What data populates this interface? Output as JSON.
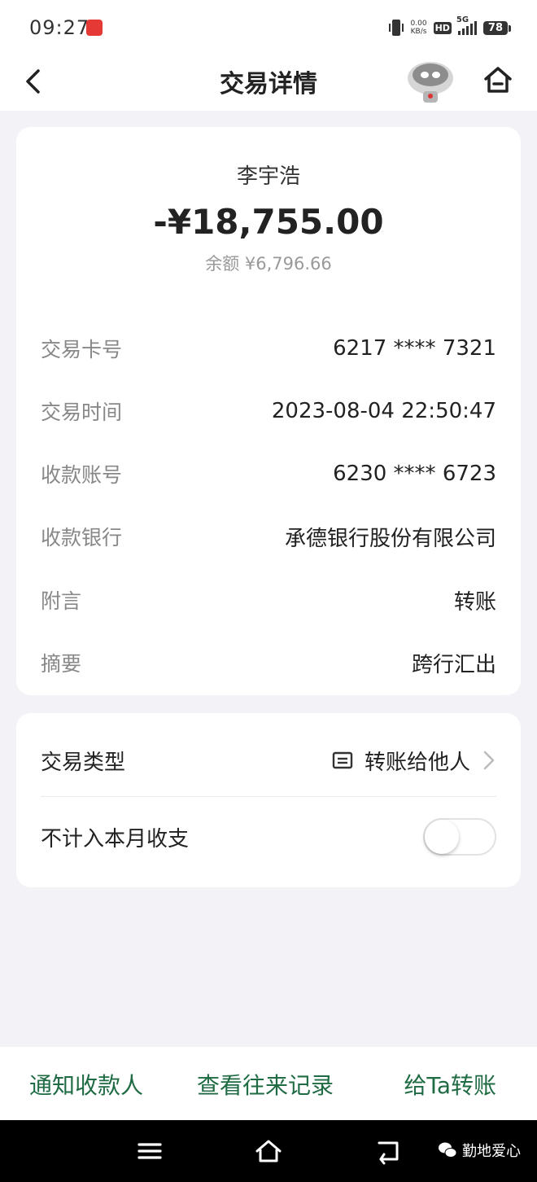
{
  "status_bar": {
    "time": "09:27",
    "net_speed_value": "0.00",
    "net_speed_unit": "KB/s",
    "hd": "HD",
    "network": "5G",
    "battery": "78"
  },
  "header": {
    "title": "交易详情",
    "back_icon": "chevron-left-icon",
    "home_icon": "home-icon"
  },
  "summary": {
    "payee_name": "李宇浩",
    "amount": "-¥18,755.00",
    "balance": "余额 ¥6,796.66"
  },
  "details": [
    {
      "label": "交易卡号",
      "value": "6217 **** 7321"
    },
    {
      "label": "交易时间",
      "value": "2023-08-04 22:50:47"
    },
    {
      "label": "收款账号",
      "value": "6230 **** 6723"
    },
    {
      "label": "收款银行",
      "value": "承德银行股份有限公司"
    },
    {
      "label": "附言",
      "value": "转账"
    },
    {
      "label": "摘要",
      "value": "跨行汇出"
    }
  ],
  "type_card": {
    "type_label": "交易类型",
    "type_value": "转账给他人",
    "toggle_label": "不计入本月收支",
    "toggle_on": false
  },
  "actions": {
    "notify": "通知收款人",
    "records": "查看往来记录",
    "transfer": "给Ta转账"
  },
  "watermark": "勤地爱心",
  "colors": {
    "action_green": "#1f6b43",
    "background": "#f3f3f7"
  }
}
